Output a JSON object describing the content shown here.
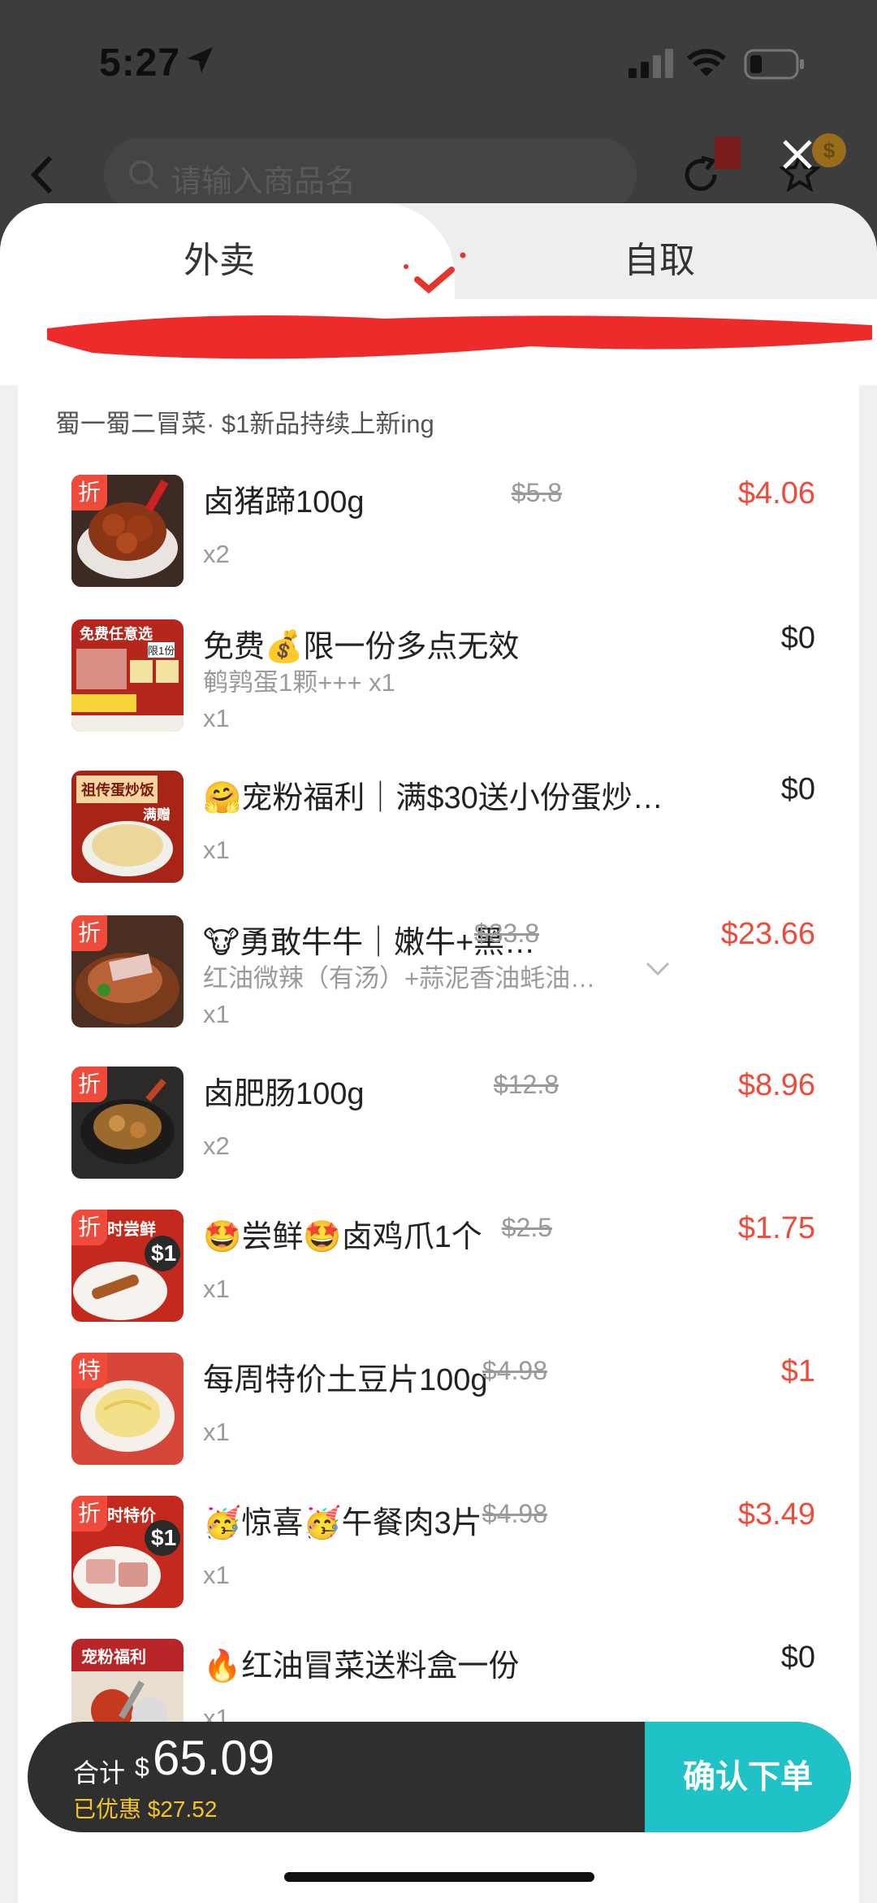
{
  "status_bar": {
    "time": "5:27"
  },
  "search": {
    "placeholder": "请输入商品名"
  },
  "tabs": [
    {
      "label": "外卖"
    },
    {
      "label": "自取"
    }
  ],
  "shop_line": "蜀一蜀二冒菜· $1新品持续上新ing",
  "items": [
    {
      "name": "卤猪蹄100g",
      "sub": "",
      "qty": "x2",
      "orig": "$5.8",
      "price": "$4.06",
      "tag": "折"
    },
    {
      "name": "免费💰限一份多点无效",
      "sub": "鹌鹑蛋1颗+++ x1",
      "qty": "x1",
      "orig": "",
      "price": "$0",
      "tag": ""
    },
    {
      "name": "🤗宠粉福利｜满$30送小份蛋炒…",
      "sub": "",
      "qty": "x1",
      "orig": "",
      "price": "$0",
      "tag": ""
    },
    {
      "name": "🐮勇敢牛牛｜嫩牛+黑…",
      "sub": "红油微辣（有汤）+蒜泥香油蚝油…",
      "qty": "x1",
      "orig": "$33.8",
      "price": "$23.66",
      "tag": "折"
    },
    {
      "name": "卤肥肠100g",
      "sub": "",
      "qty": "x2",
      "orig": "$12.8",
      "price": "$8.96",
      "tag": "折"
    },
    {
      "name": "🤩尝鲜🤩卤鸡爪1个",
      "sub": "",
      "qty": "x1",
      "orig": "$2.5",
      "price": "$1.75",
      "tag": "折"
    },
    {
      "name": "每周特价土豆片100g",
      "sub": "",
      "qty": "x1",
      "orig": "$4.98",
      "price": "$1",
      "tag": "特"
    },
    {
      "name": "🥳惊喜🥳午餐肉3片",
      "sub": "",
      "qty": "x1",
      "orig": "$4.98",
      "price": "$3.49",
      "tag": "折"
    },
    {
      "name": "🔥红油冒菜送料盒一份",
      "sub": "",
      "qty": "x1",
      "orig": "",
      "price": "$0",
      "tag": ""
    }
  ],
  "thumb_text": {
    "item2_a": "免费任意选",
    "item2_b": "限1份",
    "item3_a": "祖传蛋炒饭",
    "item3_b": "满赠",
    "item6_a": "时尝鲜",
    "item6_b": "$1",
    "item8_a": "时特价",
    "item8_b": "$1",
    "item9_a": "宠粉福利"
  },
  "summary": {
    "total_label": "合计",
    "currency": "$",
    "total": "65.09",
    "discount": "已优惠 $27.52",
    "confirm": "确认下单"
  },
  "colors": {
    "accent_red": "#f04b3a",
    "confirm_teal": "#1fc2c6",
    "discount_yellow": "#f5c425"
  }
}
